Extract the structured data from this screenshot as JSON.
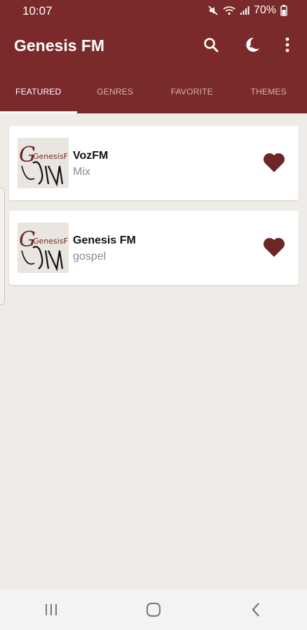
{
  "status": {
    "time": "10:07",
    "battery": "70%"
  },
  "app": {
    "title": "Genesis FM"
  },
  "tabs": [
    {
      "label": "FEATURED",
      "active": true
    },
    {
      "label": "GENRES",
      "active": false
    },
    {
      "label": "FAVORITE",
      "active": false
    },
    {
      "label": "THEMES",
      "active": false
    }
  ],
  "stations": [
    {
      "name": "VozFM",
      "genre": "Mix",
      "logo_text": "GenesisFM",
      "favorite": true
    },
    {
      "name": "Genesis FM",
      "genre": "gospel",
      "logo_text": "GenesisFM",
      "favorite": true
    }
  ],
  "icons": {
    "search": "search-icon",
    "theme": "night-mode-icon",
    "more": "more-vert-icon",
    "heart": "heart-icon",
    "recents": "recents-icon",
    "home": "home-icon",
    "back": "back-icon"
  },
  "colors": {
    "primary": "#7a2a2a",
    "heart": "#6d2626",
    "background": "#efece8"
  }
}
